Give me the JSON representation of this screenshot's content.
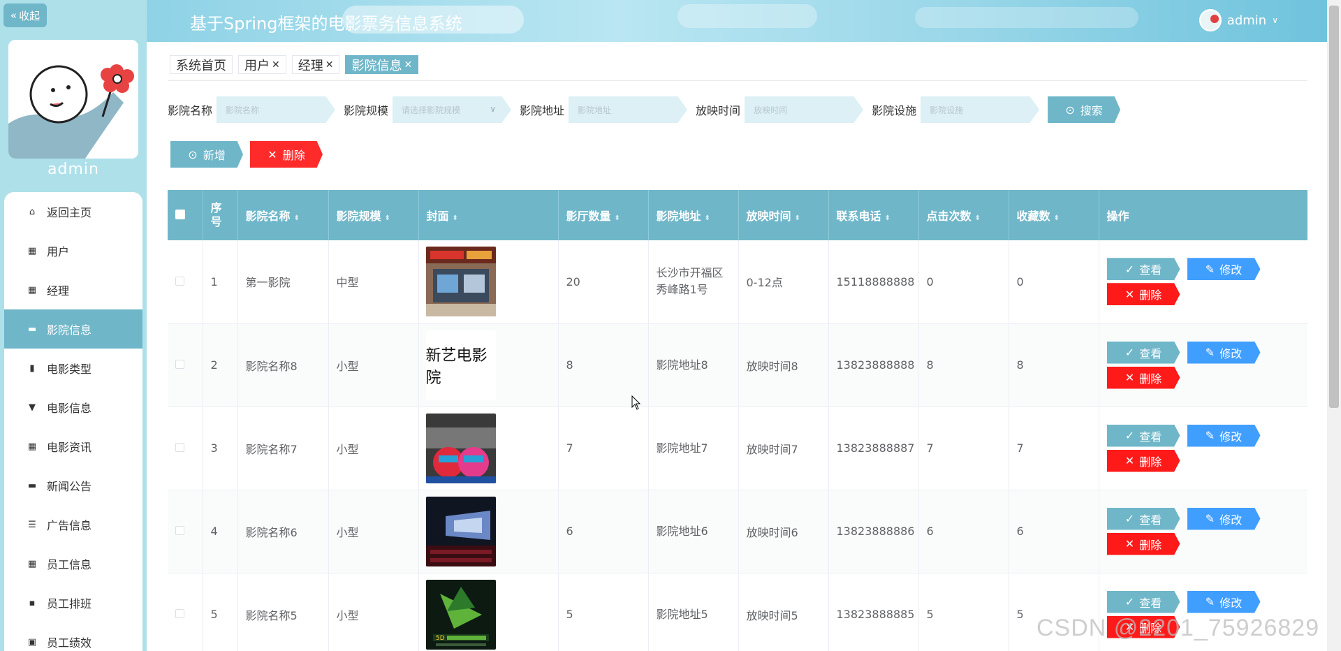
{
  "sidebar": {
    "collapse_label": "收起",
    "username": "admin",
    "menu": [
      {
        "label": "返回主页",
        "icon": "home-icon"
      },
      {
        "label": "用户",
        "icon": "grid-icon"
      },
      {
        "label": "经理",
        "icon": "grid-icon"
      },
      {
        "label": "影院信息",
        "icon": "card-icon",
        "active": true
      },
      {
        "label": "电影类型",
        "icon": "bar-chart-icon"
      },
      {
        "label": "电影信息",
        "icon": "trophy-icon"
      },
      {
        "label": "电影资讯",
        "icon": "grid-icon"
      },
      {
        "label": "新闻公告",
        "icon": "monitor-icon"
      },
      {
        "label": "广告信息",
        "icon": "list-icon"
      },
      {
        "label": "员工信息",
        "icon": "grid-icon"
      },
      {
        "label": "员工排班",
        "icon": "chat-icon"
      },
      {
        "label": "员工绩效",
        "icon": "clipboard-icon"
      }
    ]
  },
  "header": {
    "title": "基于Spring框架的电影票务信息系统",
    "user": "admin"
  },
  "tabs": [
    {
      "label": "系统首页",
      "closable": false
    },
    {
      "label": "用户",
      "closable": true
    },
    {
      "label": "经理",
      "closable": true
    },
    {
      "label": "影院信息",
      "closable": true,
      "active": true
    }
  ],
  "search": {
    "name_label": "影院名称",
    "name_placeholder": "影院名称",
    "scale_label": "影院规模",
    "scale_placeholder": "请选择影院规模",
    "address_label": "影院地址",
    "address_placeholder": "影院地址",
    "time_label": "放映时间",
    "time_placeholder": "放映时间",
    "facility_label": "影院设施",
    "facility_placeholder": "影院设施",
    "search_button": "搜索"
  },
  "actions": {
    "add": "新增",
    "delete": "删除"
  },
  "table": {
    "headers": [
      "序号",
      "影院名称",
      "影院规模",
      "封面",
      "影厅数量",
      "影院地址",
      "放映时间",
      "联系电话",
      "点击次数",
      "收藏数",
      "操作"
    ],
    "op_labels": {
      "view": "查看",
      "edit": "修改",
      "delete": "删除"
    },
    "rows": [
      {
        "idx": "1",
        "name": "第一影院",
        "scale": "中型",
        "cover": "storefront",
        "halls": "20",
        "address": "长沙市开福区秀峰路1号",
        "time": "0-12点",
        "phone": "15118888888",
        "clicks": "0",
        "favorites": "0"
      },
      {
        "idx": "2",
        "name": "影院名称8",
        "scale": "小型",
        "cover": "text-logo",
        "cover_text": "新艺电影院",
        "halls": "8",
        "address": "影院地址8",
        "time": "放映时间8",
        "phone": "13823888888",
        "clicks": "8",
        "favorites": "8"
      },
      {
        "idx": "3",
        "name": "影院名称7",
        "scale": "小型",
        "cover": "cartoon",
        "halls": "7",
        "address": "影院地址7",
        "time": "放映时间7",
        "phone": "13823888887",
        "clicks": "7",
        "favorites": "7"
      },
      {
        "idx": "4",
        "name": "影院名称6",
        "scale": "小型",
        "cover": "theater",
        "halls": "6",
        "address": "影院地址6",
        "time": "放映时间6",
        "phone": "13823888886",
        "clicks": "6",
        "favorites": "6"
      },
      {
        "idx": "5",
        "name": "影院名称5",
        "scale": "小型",
        "cover": "poster-5d",
        "halls": "5",
        "address": "影院地址5",
        "time": "放映时间5",
        "phone": "13823888885",
        "clicks": "5",
        "favorites": "5"
      }
    ]
  },
  "watermark": "CSDN @2201_75926829",
  "colors": {
    "accent": "#6fb6c9",
    "edit": "#409eff",
    "danger": "#ff1a1a"
  }
}
